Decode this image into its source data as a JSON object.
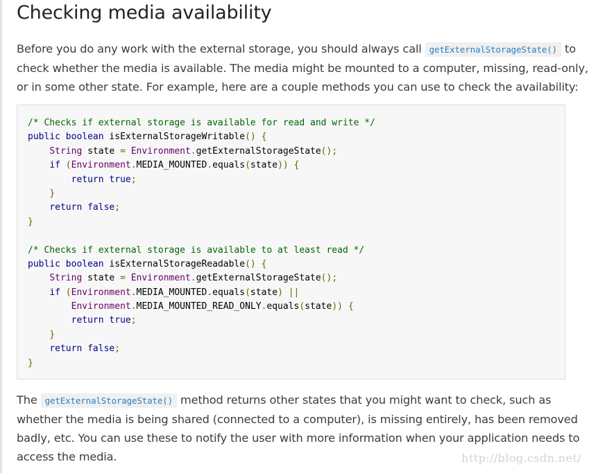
{
  "heading": "Checking media availability",
  "intro": {
    "line1_before": "Before you do any work with the external storage, you should always call ",
    "line1_code": "getExternalStorageState()",
    "line1_after": " to",
    "line2": "check whether the media is available. The media might be mounted to a computer, missing, read-only,",
    "line3": "or in some other state. For example, here are a couple methods you can use to check the availability:"
  },
  "code_lines": [
    [
      {
        "c": "com",
        "t": "/* Checks if external storage is available for read and write */"
      }
    ],
    [
      {
        "c": "kw",
        "t": "public"
      },
      {
        "c": "pln",
        "t": " "
      },
      {
        "c": "kw",
        "t": "boolean"
      },
      {
        "c": "pln",
        "t": " isExternalStorageWritable"
      },
      {
        "c": "pun",
        "t": "()"
      },
      {
        "c": "pln",
        "t": " "
      },
      {
        "c": "pun",
        "t": "{"
      }
    ],
    [
      {
        "c": "pln",
        "t": "    "
      },
      {
        "c": "typ",
        "t": "String"
      },
      {
        "c": "pln",
        "t": " state "
      },
      {
        "c": "pun",
        "t": "="
      },
      {
        "c": "pln",
        "t": " "
      },
      {
        "c": "typ",
        "t": "Environment"
      },
      {
        "c": "pun",
        "t": "."
      },
      {
        "c": "pln",
        "t": "getExternalStorageState"
      },
      {
        "c": "pun",
        "t": "();"
      }
    ],
    [
      {
        "c": "pln",
        "t": "    "
      },
      {
        "c": "kw",
        "t": "if"
      },
      {
        "c": "pln",
        "t": " "
      },
      {
        "c": "pun",
        "t": "("
      },
      {
        "c": "typ",
        "t": "Environment"
      },
      {
        "c": "pun",
        "t": "."
      },
      {
        "c": "pln",
        "t": "MEDIA_MOUNTED"
      },
      {
        "c": "pun",
        "t": "."
      },
      {
        "c": "pln",
        "t": "equals"
      },
      {
        "c": "pun",
        "t": "("
      },
      {
        "c": "pln",
        "t": "state"
      },
      {
        "c": "pun",
        "t": "))"
      },
      {
        "c": "pln",
        "t": " "
      },
      {
        "c": "pun",
        "t": "{"
      }
    ],
    [
      {
        "c": "pln",
        "t": "        "
      },
      {
        "c": "kw",
        "t": "return"
      },
      {
        "c": "pln",
        "t": " "
      },
      {
        "c": "kw",
        "t": "true"
      },
      {
        "c": "pun",
        "t": ";"
      }
    ],
    [
      {
        "c": "pln",
        "t": "    "
      },
      {
        "c": "pun",
        "t": "}"
      }
    ],
    [
      {
        "c": "pln",
        "t": "    "
      },
      {
        "c": "kw",
        "t": "return"
      },
      {
        "c": "pln",
        "t": " "
      },
      {
        "c": "kw",
        "t": "false"
      },
      {
        "c": "pun",
        "t": ";"
      }
    ],
    [
      {
        "c": "pun",
        "t": "}"
      }
    ],
    [],
    [
      {
        "c": "com",
        "t": "/* Checks if external storage is available to at least read */"
      }
    ],
    [
      {
        "c": "kw",
        "t": "public"
      },
      {
        "c": "pln",
        "t": " "
      },
      {
        "c": "kw",
        "t": "boolean"
      },
      {
        "c": "pln",
        "t": " isExternalStorageReadable"
      },
      {
        "c": "pun",
        "t": "()"
      },
      {
        "c": "pln",
        "t": " "
      },
      {
        "c": "pun",
        "t": "{"
      }
    ],
    [
      {
        "c": "pln",
        "t": "    "
      },
      {
        "c": "typ",
        "t": "String"
      },
      {
        "c": "pln",
        "t": " state "
      },
      {
        "c": "pun",
        "t": "="
      },
      {
        "c": "pln",
        "t": " "
      },
      {
        "c": "typ",
        "t": "Environment"
      },
      {
        "c": "pun",
        "t": "."
      },
      {
        "c": "pln",
        "t": "getExternalStorageState"
      },
      {
        "c": "pun",
        "t": "();"
      }
    ],
    [
      {
        "c": "pln",
        "t": "    "
      },
      {
        "c": "kw",
        "t": "if"
      },
      {
        "c": "pln",
        "t": " "
      },
      {
        "c": "pun",
        "t": "("
      },
      {
        "c": "typ",
        "t": "Environment"
      },
      {
        "c": "pun",
        "t": "."
      },
      {
        "c": "pln",
        "t": "MEDIA_MOUNTED"
      },
      {
        "c": "pun",
        "t": "."
      },
      {
        "c": "pln",
        "t": "equals"
      },
      {
        "c": "pun",
        "t": "("
      },
      {
        "c": "pln",
        "t": "state"
      },
      {
        "c": "pun",
        "t": ")"
      },
      {
        "c": "pln",
        "t": " "
      },
      {
        "c": "pun",
        "t": "||"
      }
    ],
    [
      {
        "c": "pln",
        "t": "        "
      },
      {
        "c": "typ",
        "t": "Environment"
      },
      {
        "c": "pun",
        "t": "."
      },
      {
        "c": "pln",
        "t": "MEDIA_MOUNTED_READ_ONLY"
      },
      {
        "c": "pun",
        "t": "."
      },
      {
        "c": "pln",
        "t": "equals"
      },
      {
        "c": "pun",
        "t": "("
      },
      {
        "c": "pln",
        "t": "state"
      },
      {
        "c": "pun",
        "t": "))"
      },
      {
        "c": "pln",
        "t": " "
      },
      {
        "c": "pun",
        "t": "{"
      }
    ],
    [
      {
        "c": "pln",
        "t": "        "
      },
      {
        "c": "kw",
        "t": "return"
      },
      {
        "c": "pln",
        "t": " "
      },
      {
        "c": "kw",
        "t": "true"
      },
      {
        "c": "pun",
        "t": ";"
      }
    ],
    [
      {
        "c": "pln",
        "t": "    "
      },
      {
        "c": "pun",
        "t": "}"
      }
    ],
    [
      {
        "c": "pln",
        "t": "    "
      },
      {
        "c": "kw",
        "t": "return"
      },
      {
        "c": "pln",
        "t": " "
      },
      {
        "c": "kw",
        "t": "false"
      },
      {
        "c": "pun",
        "t": ";"
      }
    ],
    [
      {
        "c": "pun",
        "t": "}"
      }
    ]
  ],
  "outro": {
    "line1_before": "The ",
    "line1_code": "getExternalStorageState()",
    "line1_after": " method returns other states that you might want to check, such as",
    "line2": "whether the media is being shared (connected to a computer), is missing entirely, has been removed",
    "line3": "badly, etc. You can use these to notify the user with more information when your application needs to",
    "line4": "access the media."
  },
  "watermark": "http://blog.csdn.net/",
  "colors": {
    "comment": "#006600",
    "keyword": "#000088",
    "type": "#660066",
    "punctuation": "#666600",
    "inline_code": "#2a7fc0"
  }
}
